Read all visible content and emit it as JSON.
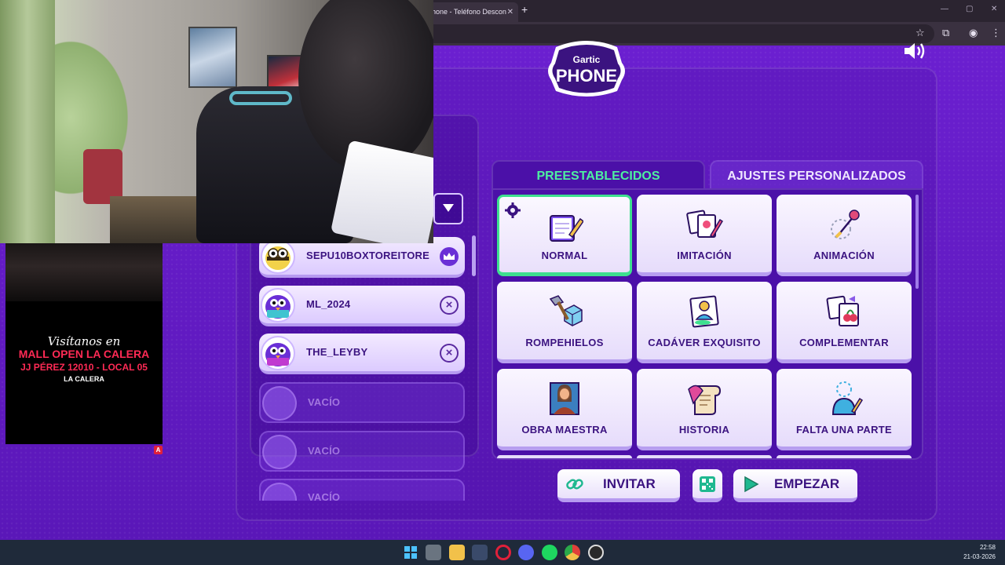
{
  "browser": {
    "tab_title": "hone - Teléfono Descon",
    "tab_close": "✕",
    "new_tab": "+",
    "window_controls": [
      "—",
      "▢",
      "✕"
    ]
  },
  "game": {
    "logo_top": "Gartic",
    "logo_bottom": "PHONE"
  },
  "players": [
    {
      "name": "SEPU10BOXTOREITORE",
      "role": "host",
      "state": "filled"
    },
    {
      "name": "ML_2024",
      "role": "guest",
      "state": "filled"
    },
    {
      "name": "THE_LEYBY",
      "role": "guest",
      "state": "filled"
    },
    {
      "name": "VACÍO",
      "state": "empty"
    },
    {
      "name": "VACÍO",
      "state": "empty"
    },
    {
      "name": "VACÍO",
      "state": "empty"
    }
  ],
  "tabs": {
    "preset": "PREESTABLECIDOS",
    "custom": "AJUSTES PERSONALIZADOS"
  },
  "modes": [
    {
      "label": "NORMAL",
      "icon": "notebook-pencil-icon",
      "selected": true
    },
    {
      "label": "IMITACIÓN",
      "icon": "cards-pencil-icon",
      "selected": false
    },
    {
      "label": "ANIMACIÓN",
      "icon": "pin-icon",
      "selected": false
    },
    {
      "label": "ROMPEHIELOS",
      "icon": "hammer-ice-icon",
      "selected": false
    },
    {
      "label": "CADÁVER EXQUISITO",
      "icon": "portrait-icon",
      "selected": false
    },
    {
      "label": "COMPLEMENTAR",
      "icon": "cherry-cards-icon",
      "selected": false
    },
    {
      "label": "OBRA MAESTRA",
      "icon": "painting-icon",
      "selected": false
    },
    {
      "label": "HISTORIA",
      "icon": "scroll-quill-icon",
      "selected": false
    },
    {
      "label": "FALTA UNA PARTE",
      "icon": "missing-head-icon",
      "selected": false
    }
  ],
  "actions": {
    "invite": "INVITAR",
    "start": "EMPEZAR"
  },
  "ad": {
    "line1": "Visítanos en",
    "line2": "MALL OPEN LA CALERA",
    "line3": "JJ PÉREZ 12010 - LOCAL 05",
    "line4": "LA CALERA",
    "badge": "A"
  },
  "taskbar": {
    "time": "22:58",
    "date": "21-03-2026"
  },
  "colors": {
    "page_bg": "#6a1fc9",
    "accent_green": "#3ee08f",
    "panel": "#4b10a8",
    "text_dark": "#3b1380"
  }
}
